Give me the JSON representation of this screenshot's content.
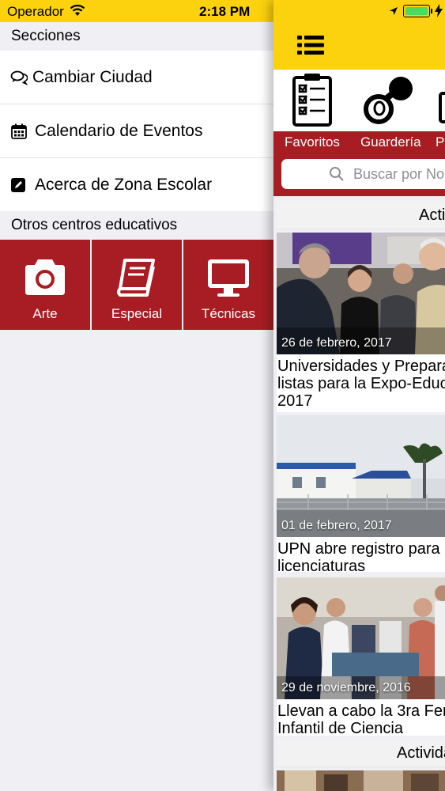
{
  "status": {
    "carrier": "Operador",
    "time": "2:18 PM"
  },
  "menu": {
    "sections_header": "Secciones",
    "items": [
      {
        "label": "Cambiar Ciudad",
        "icon": "chat-bubbles-icon"
      },
      {
        "label": "Calendario de Eventos",
        "icon": "calendar-icon"
      },
      {
        "label": "Acerca de Zona Escolar",
        "icon": "edit-icon"
      }
    ],
    "others_header": "Otros centros educativos",
    "centers": [
      {
        "label": "Arte",
        "icon": "camera-icon"
      },
      {
        "label": "Especial",
        "icon": "book-icon"
      },
      {
        "label": "Técnicas",
        "icon": "monitor-icon"
      }
    ]
  },
  "main": {
    "categories": [
      {
        "label": "Favoritos",
        "icon": "checklist-icon"
      },
      {
        "label": "Guardería",
        "icon": "pacifier-icon"
      },
      {
        "label": "P",
        "icon": "partial-icon"
      }
    ],
    "search_placeholder": "Buscar por No",
    "section_title": "Acti",
    "section_title_2": "Activida",
    "news": [
      {
        "date": "26 de febrero, 2017",
        "title": "Universidades y Preparat\nlistas para la Expo-Educa\n2017"
      },
      {
        "date": "01 de febrero, 2017",
        "title": "UPN abre registro para\nlicenciaturas"
      },
      {
        "date": "29 de noviembre, 2016",
        "title": "Llevan a cabo la 3ra Feria\nInfantil de Ciencia"
      }
    ]
  },
  "colors": {
    "brand_yellow": "#fcd20e",
    "brand_red": "#a71d23",
    "background": "#efeff4"
  }
}
